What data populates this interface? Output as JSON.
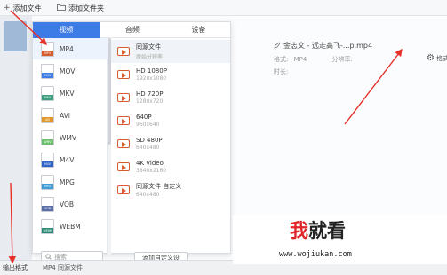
{
  "toolbar": {
    "add_file": "添加文件",
    "add_folder": "添加文件夹"
  },
  "file": {
    "title": "金志文 - 远走高飞-...p.mp4",
    "format_label": "格式:",
    "format_value": "MP4",
    "resolution_label": "分辨率:",
    "duration_label": "时长:",
    "settings_label": "格式"
  },
  "tabs": [
    {
      "label": "视频"
    },
    {
      "label": "音频"
    },
    {
      "label": "设备"
    }
  ],
  "formats": [
    {
      "label": "MP4",
      "color": "#d65b2d"
    },
    {
      "label": "MOV",
      "color": "#3d7ce6"
    },
    {
      "label": "MKV",
      "color": "#3f9e7e"
    },
    {
      "label": "AVI",
      "color": "#e2962a"
    },
    {
      "label": "WMV",
      "color": "#6bc06a"
    },
    {
      "label": "M4V",
      "color": "#2f63c8"
    },
    {
      "label": "MPG",
      "color": "#3f9bd8"
    },
    {
      "label": "VOB",
      "color": "#5a6ea8"
    },
    {
      "label": "WEBM",
      "color": "#2b8a75"
    }
  ],
  "search": {
    "placeholder": "搜索"
  },
  "presets": [
    {
      "name": "同源文件",
      "res": "原始分辨率"
    },
    {
      "name": "HD 1080P",
      "res": "1920x1080"
    },
    {
      "name": "HD 720P",
      "res": "1280x720"
    },
    {
      "name": "640P",
      "res": "960x640"
    },
    {
      "name": "SD 480P",
      "res": "640x480"
    },
    {
      "name": "4K Video",
      "res": "3840x2160"
    },
    {
      "name": "同源文件 自定义",
      "res": "640x480"
    }
  ],
  "add_custom": "添加自定义设",
  "bottom": {
    "output_label": "输出格式",
    "output_value": "MP4  同源文件"
  },
  "watermark": {
    "logo_red": "我",
    "logo_rest": "就看",
    "url": "www.wojiukan.com"
  },
  "colors": {
    "accent": "#3d7ce6",
    "annotation": "#e8302a"
  }
}
